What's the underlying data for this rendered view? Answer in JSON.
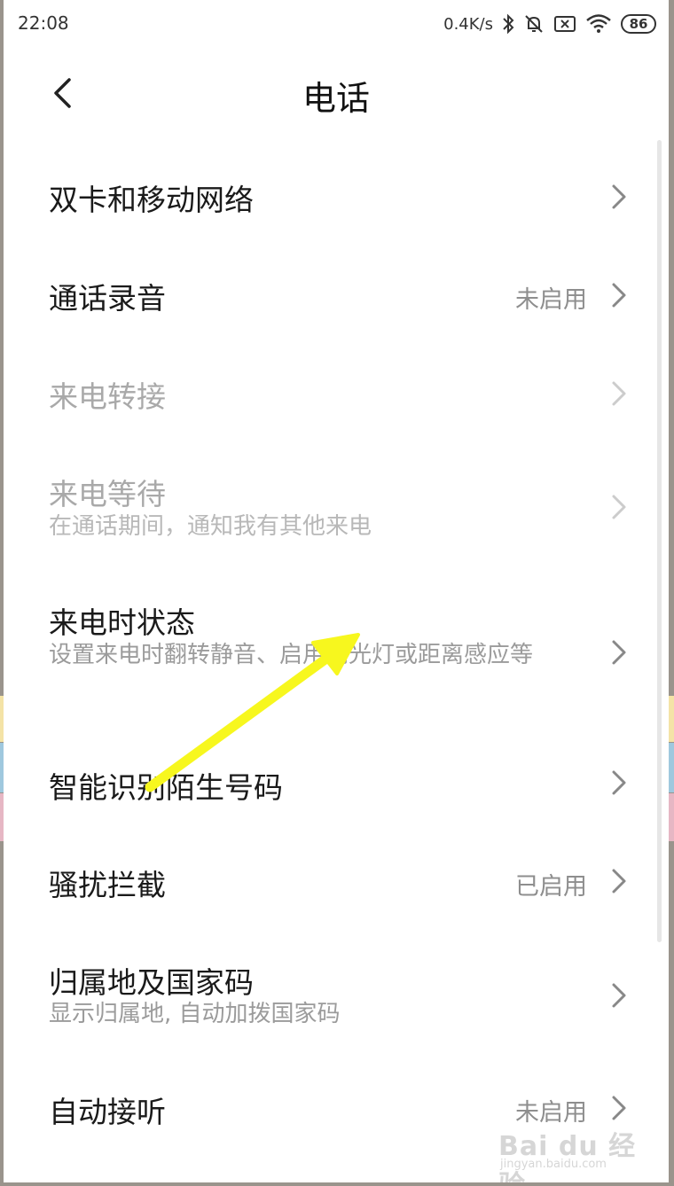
{
  "status_bar": {
    "time": "22:08",
    "net_speed": "0.4K/s",
    "battery": "86"
  },
  "header": {
    "title": "电话"
  },
  "items": [
    {
      "title": "双卡和移动网络",
      "subtitle": "",
      "value": ""
    },
    {
      "title": "通话录音",
      "subtitle": "",
      "value": "未启用"
    },
    {
      "title": "来电转接",
      "subtitle": "",
      "value": "",
      "disabled": true
    },
    {
      "title": "来电等待",
      "subtitle": "在通话期间，通知我有其他来电",
      "value": "",
      "disabled": true
    },
    {
      "title": "来电时状态",
      "subtitle": "设置来电时翻转静音、启用闪光灯或距离感应等",
      "value": ""
    },
    {
      "title": "智能识别陌生号码",
      "subtitle": "",
      "value": ""
    },
    {
      "title": "骚扰拦截",
      "subtitle": "",
      "value": "已启用"
    },
    {
      "title": "归属地及国家码",
      "subtitle": "显示归属地, 自动加拨国家码",
      "value": ""
    },
    {
      "title": "自动接听",
      "subtitle": "",
      "value": "未启用"
    }
  ],
  "watermark": {
    "main": "Bai du 经验",
    "sub": "jingyan.baidu.com"
  },
  "colors": {
    "annotation_arrow": "#f7f71e",
    "chevron": "#888888",
    "chevron_disabled": "#cccccc"
  }
}
